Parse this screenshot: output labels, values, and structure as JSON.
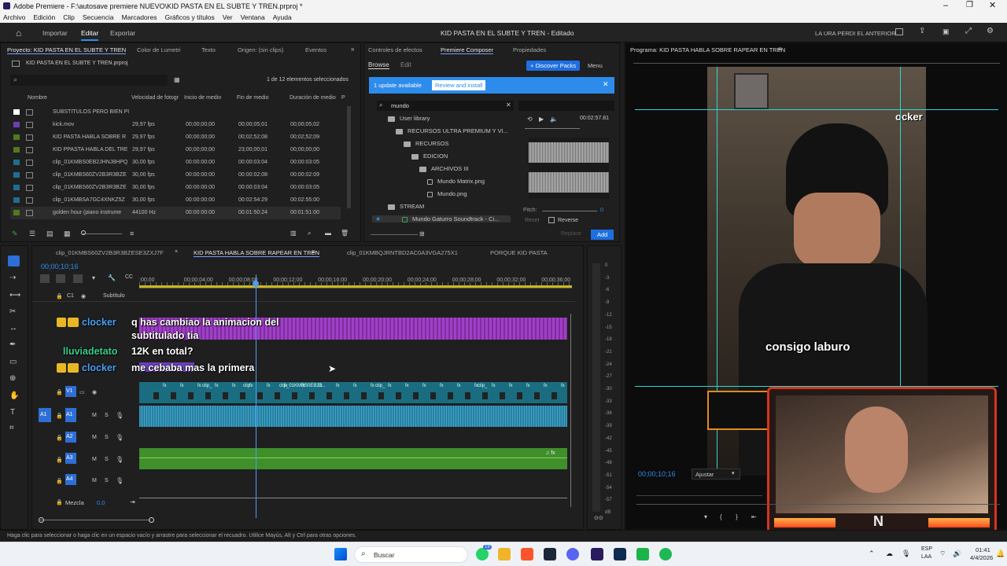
{
  "app": {
    "titlebar": "Adobe Premiere - F:\\autosave premiere NUEVO\\KID PASTA EN EL SUBTE Y TREN.prproj *",
    "menu": [
      "Archivo",
      "Edición",
      "Clip",
      "Secuencia",
      "Marcadores",
      "Gráficos y títulos",
      "Ver",
      "Ventana",
      "Ayuda"
    ]
  },
  "header": {
    "tabs": [
      "Importar",
      "Editar",
      "Exportar"
    ],
    "active": "Editar",
    "center": "KID PASTA EN EL SUBTE Y TREN - Editado",
    "right": "LA URA PERDI EL ANTERIOR"
  },
  "project": {
    "tabs": [
      "Proyecto: KID PASTA EN EL SUBTE Y TREN",
      "Color de Lumetri",
      "Texto",
      "Origen: (sin clips)",
      "Eventos"
    ],
    "file": "KID PASTA EN EL SUBTE Y TREN.prproj",
    "count": "1 de 12 elementos seleccionados",
    "columns": [
      "Nombre",
      "Velocidad de fotogr",
      "Inicio de medio",
      "Fin de medio",
      "Duración de medio",
      "P"
    ],
    "rows": [
      {
        "name": "SUBSTITULOS PERO BIEN PI",
        "fps": "",
        "in": "",
        "out": "",
        "dur": "",
        "color": "#ffffff"
      },
      {
        "name": "kick.mov",
        "fps": "29,97 fps",
        "in": "00;00;00;00",
        "out": "00;00;05;01",
        "dur": "00;00;05;02",
        "color": "#6b3fb8"
      },
      {
        "name": "KID PASTA HABLA SOBRE R",
        "fps": "29,97 fps",
        "in": "00;00;00;00",
        "out": "00;02;52;08",
        "dur": "00;02;52;09",
        "color": "#4f7a1e"
      },
      {
        "name": "KID PPASTA HABLA DEL TRE",
        "fps": "29,97 fps",
        "in": "00;00;00;00",
        "out": "23;00;00;01",
        "dur": "00;00;00;00",
        "color": "#4f7a1e"
      },
      {
        "name": "clip_01KMBS0EB2JHNJ8HPQ",
        "fps": "30,00 fps",
        "in": "00:00:00:00",
        "out": "00:00:03:04",
        "dur": "00:00:03:05",
        "color": "#1e6f8f"
      },
      {
        "name": "clip_01KMBS60ZV2B3R3BZE",
        "fps": "30,00 fps",
        "in": "00:00:00:00",
        "out": "00:00:02:08",
        "dur": "00:00:02:09",
        "color": "#1e6f8f"
      },
      {
        "name": "clip_01KMBS60ZV2B3R3BZE",
        "fps": "30,00 fps",
        "in": "00:00:00:00",
        "out": "00:00:03:04",
        "dur": "00:00:03:05",
        "color": "#1e6f8f"
      },
      {
        "name": "clip_01KMBSA7GC4XNKZ5Z",
        "fps": "30,00 fps",
        "in": "00:00:00:00",
        "out": "00:02:54:29",
        "dur": "00:02:55:00",
        "color": "#1e6f8f"
      },
      {
        "name": "golden hour (piano instrume",
        "fps": "44100 Hz",
        "in": "00:00:00:00",
        "out": "00:01:50:24",
        "dur": "00:01:51:00",
        "color": "#4f7a1e"
      }
    ]
  },
  "composer": {
    "tabs": [
      "Controles de efectos",
      "Premiere Composer",
      "Propiedades"
    ],
    "sub": [
      "Browse",
      "Edit"
    ],
    "discover": "+ Discover Packs",
    "menu": "Menu",
    "banner": "1 update available",
    "review": "Review and install",
    "search": "mundo",
    "tree": [
      "User library",
      "RECURSOS ULTRA PREMIUM Y VI...",
      "RECURSOS",
      "EDICION",
      "ARCHIVOS III",
      "Mundo Matrix.png",
      "Mundo.png",
      "STREAM",
      "Mundo Gaturro Soundtrack - Ci..."
    ],
    "time": "00:02:57.81",
    "pitch": "Pitch:",
    "pitch_val": "0",
    "reset": "Reset",
    "reverse": "Reverse",
    "replace": "Replace",
    "add": "Add"
  },
  "program": {
    "title": "Programa: KID PASTA HABLA SOBRE RAPEAR EN TREN",
    "timecode": "00;00;10;16",
    "fit": "Ajustar",
    "caption": "consigo laburo",
    "corner": "ocker",
    "logo": "N"
  },
  "timeline": {
    "tabs": [
      "clip_01KMBS60ZV2B3R3BZESE3ZXJ7F",
      "KID PASTA HABLA SOBRE RAPEAR EN TREN",
      "clip_01KMBQJRNTBD2AC0A3VGA275X1",
      "PORQUE KID PASTA"
    ],
    "timecode": "00;00;10;16",
    "ruler": [
      ":00;00",
      "00;00;04;00",
      "00;00;08;00",
      "00;00;12;00",
      "00;00;16;00",
      "00;00;20;00",
      "00;00;24;00",
      "00;00;28;00",
      "00;00;32;00",
      "00;00;36;00"
    ],
    "tracks": {
      "sub": "Subtítulo",
      "v1": "V1",
      "a1": "A1",
      "a2": "A2",
      "a3": "A3",
      "a4": "A4",
      "mix": "Mezcla",
      "mix_val": "0,0"
    },
    "clips": [
      "clip_",
      "clip",
      "clip_01KMBS0EB2J...",
      "clip_",
      "clip_"
    ],
    "meter": [
      "0",
      "-3",
      "-6",
      "-9",
      "-12",
      "-15",
      "-18",
      "-21",
      "-24",
      "-27",
      "-30",
      "-33",
      "-36",
      "-39",
      "-42",
      "-45",
      "-48",
      "-51",
      "-54",
      "-57",
      "dB"
    ]
  },
  "chat": [
    {
      "user": "clocker",
      "msg1": "q has cambiao la animacion del",
      "msg2": "subtitulado tia"
    },
    {
      "user": "lluviadetato",
      "msg1": "12K en total?"
    },
    {
      "user": "clocker",
      "msg1": "me cebaba mas la primera"
    }
  ],
  "status": "Haga clic para seleccionar o haga clic en un espacio vacío y arrastre para seleccionar el recuadro. Utilice Mayús, Alt y Ctrl para otras opciones.",
  "taskbar": {
    "search": "Buscar",
    "lang": "ESP",
    "lang2": "LAA",
    "time": "01:41",
    "date": "4/4/2026",
    "badge": "19"
  }
}
